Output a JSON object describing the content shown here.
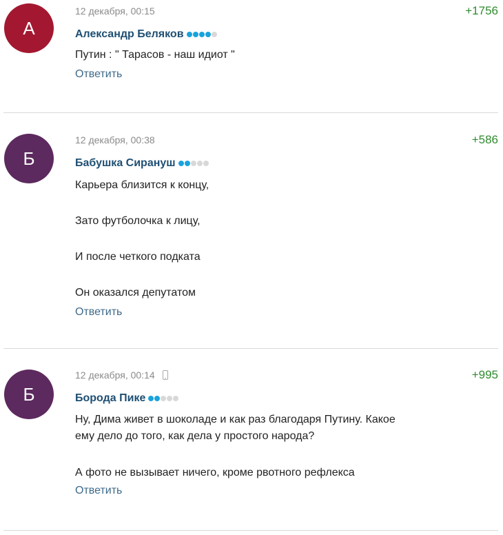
{
  "comments": [
    {
      "avatar_letter": "А",
      "avatar_color": "#a31830",
      "timestamp": "12 декабря, 00:15",
      "author": "Александр Беляков",
      "rating": "+1756",
      "level_dots": 4,
      "text": [
        "Путин : \" Тарасов - наш идиот \""
      ],
      "reply_label": "Ответить"
    },
    {
      "avatar_letter": "Б",
      "avatar_color": "#5c2a5e",
      "timestamp": "12 декабря, 00:38",
      "author": "Бабушка Сирануш",
      "rating": "+586",
      "level_dots": 2,
      "text": [
        "Карьера близится к концу,",
        "Зато футболочка к лицу,",
        "И после четкого подката",
        "Он оказался депутатом"
      ],
      "reply_label": "Ответить"
    },
    {
      "avatar_letter": "Б",
      "avatar_color": "#5c2a5e",
      "timestamp": "12 декабря, 00:14",
      "device_icon": "mobile-phone-icon",
      "author": "Борода Пике",
      "rating": "+995",
      "level_dots": 2,
      "text": [
        "Ну, Дима живет в шоколаде и как раз благодаря Путину. Какое",
        "ему дело до того, как дела у простого народа?",
        "А фото не вызывает ничего, кроме рвотного рефлекса"
      ],
      "reply_label": "Ответить"
    }
  ],
  "colors": {
    "author": "#1e4f73",
    "reply": "#3e6a8a",
    "rating": "#2e8b2e",
    "timestamp": "#8a8a8a",
    "dot_on": "#1aa3dc",
    "dot_off": "#d8d8d8",
    "divider": "#d9d9d9"
  }
}
